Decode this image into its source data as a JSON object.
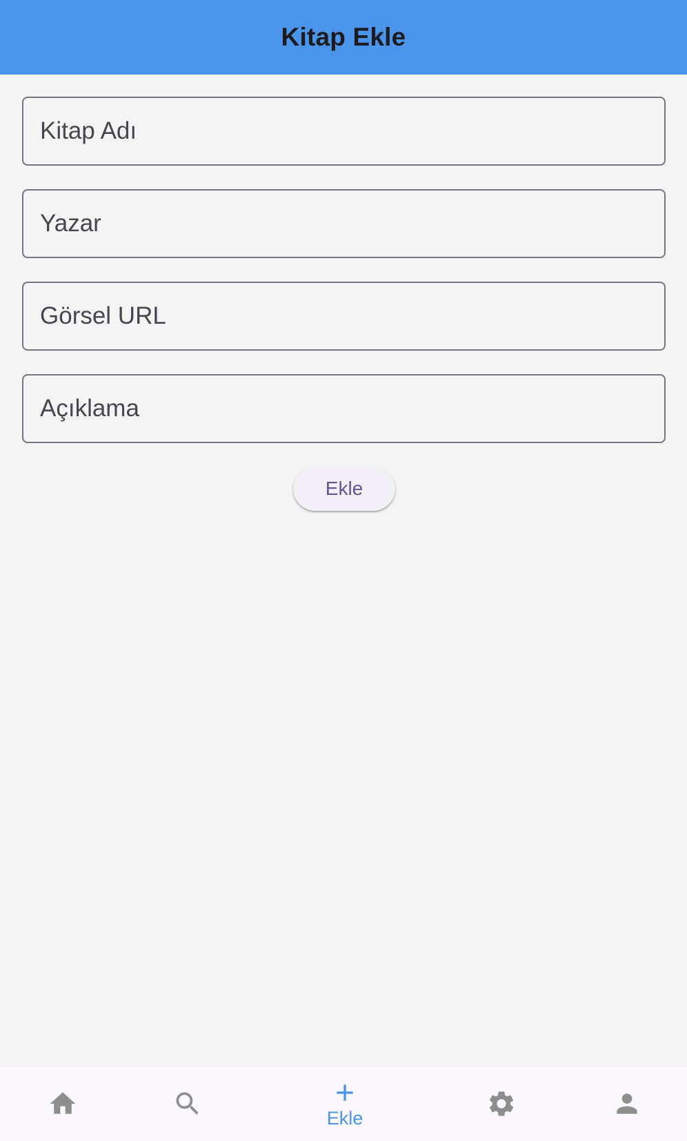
{
  "app_bar": {
    "title": "Kitap Ekle"
  },
  "form": {
    "fields": [
      {
        "placeholder": "Kitap Adı",
        "value": ""
      },
      {
        "placeholder": "Yazar",
        "value": ""
      },
      {
        "placeholder": "Görsel URL",
        "value": ""
      },
      {
        "placeholder": "Açıklama",
        "value": ""
      }
    ],
    "submit_label": "Ekle"
  },
  "bottom_nav": {
    "items": [
      {
        "icon": "home-icon",
        "label": "",
        "active": false
      },
      {
        "icon": "search-icon",
        "label": "",
        "active": false
      },
      {
        "icon": "add-icon",
        "label": "Ekle",
        "active": true
      },
      {
        "icon": "settings-icon",
        "label": "",
        "active": false
      },
      {
        "icon": "person-icon",
        "label": "",
        "active": false
      }
    ]
  },
  "colors": {
    "app_bar": "#4a94ea",
    "background": "#f4f4f5",
    "active_nav": "#4a94ea",
    "inactive_nav": "#8e8e8e",
    "button_text": "#65558f"
  }
}
